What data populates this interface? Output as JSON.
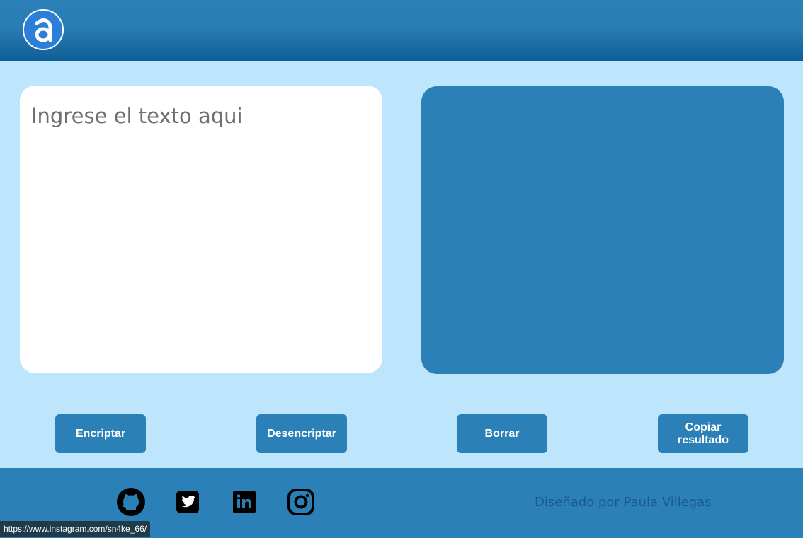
{
  "header": {
    "logo_icon": "letter-a-logo-icon"
  },
  "input": {
    "placeholder": "Ingrese el texto aqui",
    "value": ""
  },
  "output": {
    "text": ""
  },
  "buttons": {
    "encrypt": "Encriptar",
    "decrypt": "Desencriptar",
    "clear": "Borrar",
    "copy": "Copiar resultado"
  },
  "footer": {
    "social": [
      {
        "icon": "github-icon"
      },
      {
        "icon": "twitter-icon"
      },
      {
        "icon": "linkedin-icon"
      },
      {
        "icon": "instagram-icon"
      }
    ],
    "credit": "Diseñado por Paula Villegas"
  },
  "status_bar": {
    "url": "https://www.instagram.com/sn4ke_66/"
  },
  "colors": {
    "page_background": "#bde5fc",
    "primary_blue": "#2b80b8",
    "header_dark": "#0f5f96",
    "logo_blue": "#2b7fd9"
  }
}
